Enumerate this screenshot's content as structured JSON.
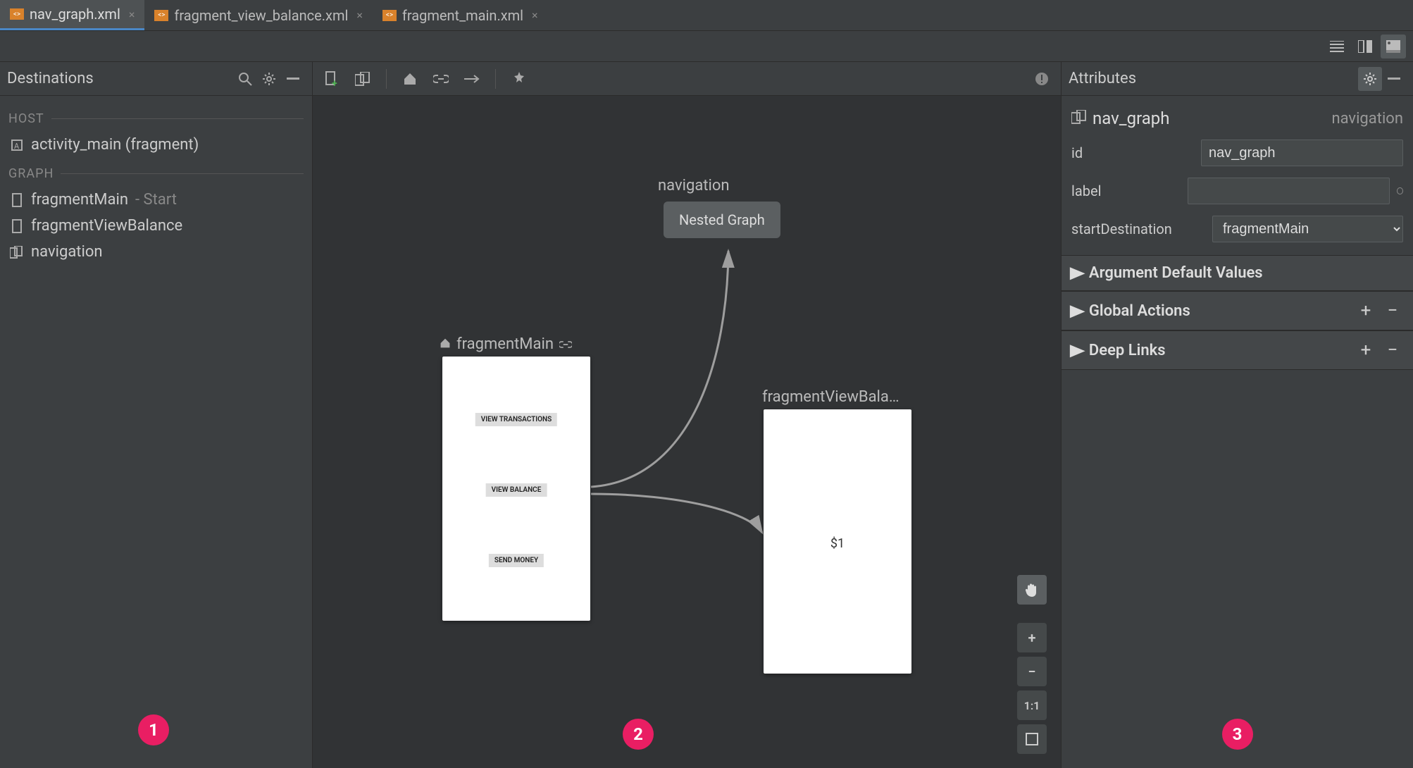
{
  "tabs": [
    {
      "label": "nav_graph.xml",
      "active": true
    },
    {
      "label": "fragment_view_balance.xml",
      "active": false
    },
    {
      "label": "fragment_main.xml",
      "active": false
    }
  ],
  "destinations": {
    "title": "Destinations",
    "host_label": "HOST",
    "host_item": "activity_main (fragment)",
    "graph_label": "GRAPH",
    "items": [
      {
        "name": "fragmentMain",
        "suffix": "- Start"
      },
      {
        "name": "fragmentViewBalance",
        "suffix": ""
      },
      {
        "name": "navigation",
        "suffix": ""
      }
    ]
  },
  "canvas": {
    "navigation_label": "navigation",
    "nested_label": "Nested Graph",
    "main_title": "fragmentMain",
    "balance_title": "fragmentViewBala…",
    "main_buttons": [
      "VIEW TRANSACTIONS",
      "VIEW BALANCE",
      "SEND MONEY"
    ],
    "balance_text": "$1",
    "zoom_one": "1:1",
    "badges": {
      "left": "1",
      "center": "2",
      "right": "3"
    }
  },
  "attributes": {
    "title": "Attributes",
    "node_name": "nav_graph",
    "node_type": "navigation",
    "rows": {
      "id_key": "id",
      "id_value": "nav_graph",
      "label_key": "label",
      "label_value": "",
      "start_key": "startDestination",
      "start_value": "fragmentMain"
    },
    "sections": {
      "argdef": "Argument Default Values",
      "global": "Global Actions",
      "deeplinks": "Deep Links"
    }
  }
}
